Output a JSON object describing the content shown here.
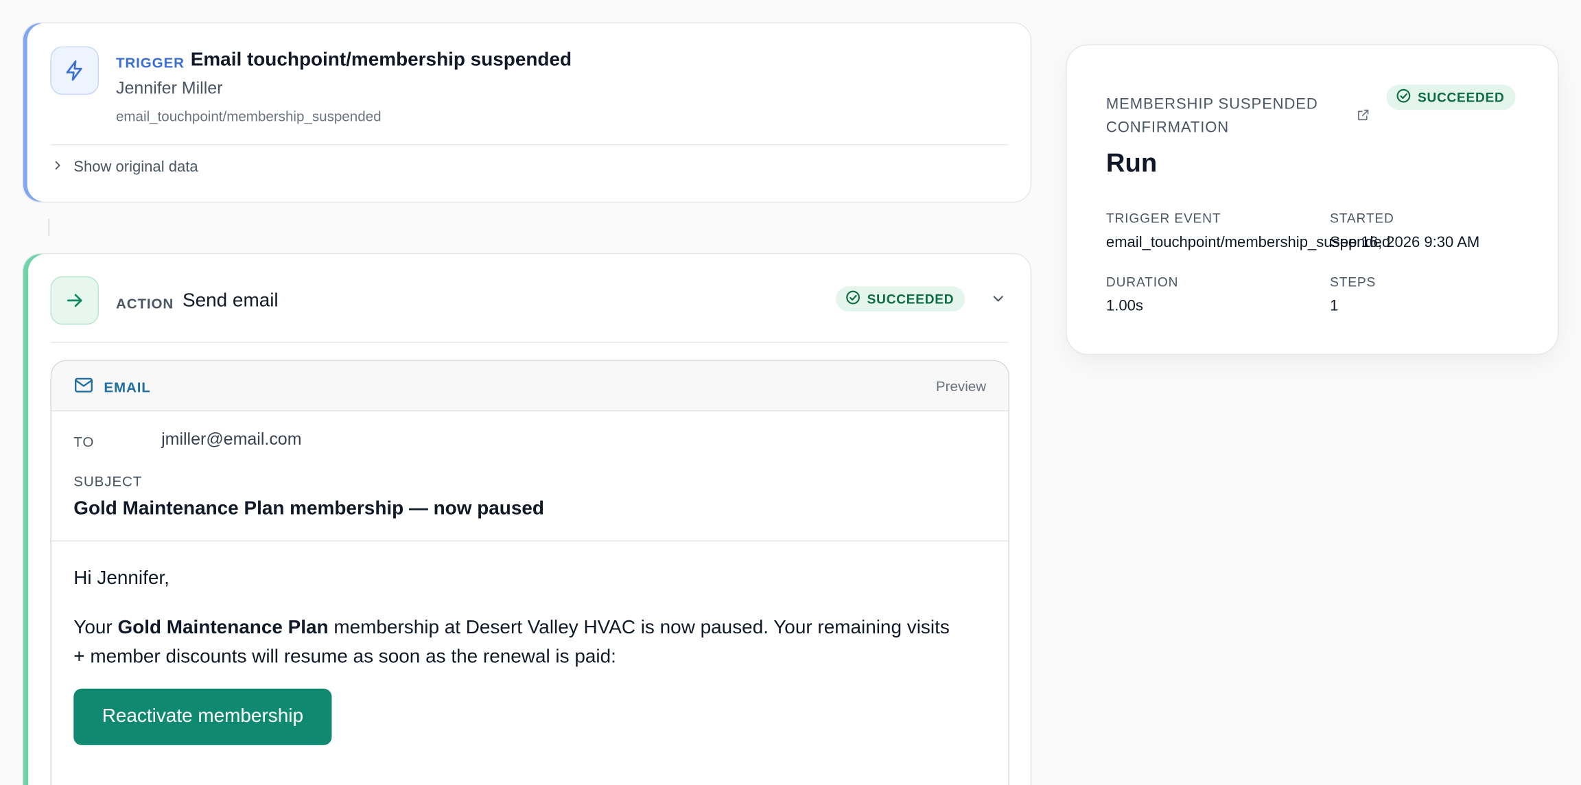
{
  "trigger": {
    "kind_label": "TRIGGER",
    "title": "Email touchpoint/membership suspended",
    "person": "Jennifer Miller",
    "event_slug": "email_touchpoint/membership_suspended",
    "show_original_label": "Show original data",
    "icon": "lightning-bolt-icon",
    "accent_color": "#7fa6ee"
  },
  "action": {
    "kind_label": "ACTION",
    "title": "Send email",
    "status": "SUCCEEDED",
    "icon": "arrow-right-icon",
    "accent_color": "#6fd3a8",
    "email": {
      "section_label": "EMAIL",
      "preview_label": "Preview",
      "to_label": "TO",
      "to_value": "jmiller@email.com",
      "subject_label": "SUBJECT",
      "subject_value": "Gold Maintenance Plan membership — now paused",
      "greeting": "Hi Jennifer,",
      "body": {
        "prefix": "Your ",
        "plan_name": "Gold Maintenance Plan",
        "suffix": " membership at Desert Valley HVAC is now paused. Your remaining visits + member discounts will resume as soon as the renewal is paid:"
      },
      "cta_label": "Reactivate membership",
      "cta_color": "#0f8a70"
    }
  },
  "run": {
    "workflow_name": "MEMBERSHIP SUSPENDED CONFIRMATION",
    "status": "SUCCEEDED",
    "title": "Run",
    "trigger_event_label": "TRIGGER EVENT",
    "trigger_event_value": "email_touchpoint/membership_suspended",
    "started_label": "STARTED",
    "started_value": "Sep 16, 2026 9:30 AM",
    "duration_label": "DURATION",
    "duration_value": "1.00s",
    "steps_label": "STEPS",
    "steps_value": "1"
  },
  "colors": {
    "success_bg": "#e3f5ec",
    "success_text": "#0d6b45",
    "trigger_kind": "#3b6fd6",
    "email_label": "#1f6fa3"
  }
}
